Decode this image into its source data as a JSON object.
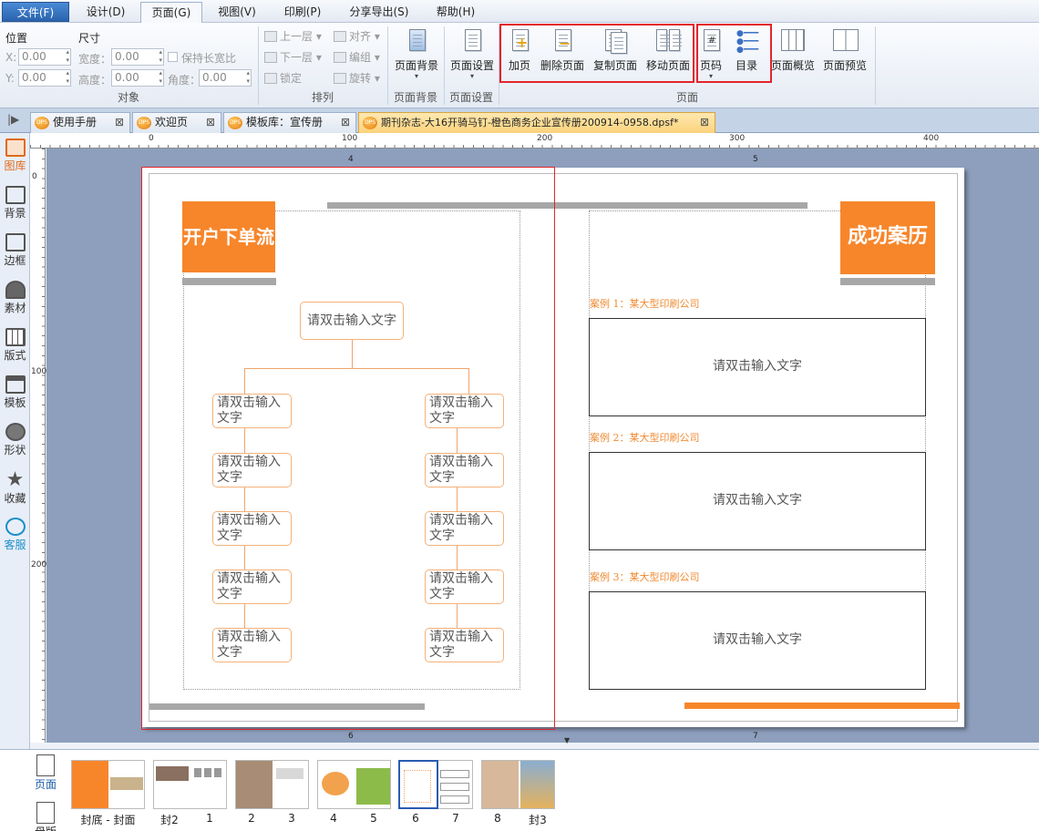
{
  "menu": {
    "file": "文件(F)",
    "items": [
      "设计(D)",
      "页面(G)",
      "视图(V)",
      "印刷(P)",
      "分享导出(S)",
      "帮助(H)"
    ]
  },
  "ribbon": {
    "object": {
      "position": "位置",
      "size": "尺寸",
      "x": "X:",
      "y": "Y:",
      "x_val": "0.00",
      "y_val": "0.00",
      "width": "宽度：",
      "height": "高度：",
      "angle": "角度：",
      "w_val": "0.00",
      "h_val": "0.00",
      "a_val": "0.00",
      "keep_ratio": "保持长宽比",
      "group": "对象"
    },
    "arrange": {
      "up": "上一层",
      "down": "下一层",
      "lock": "锁定",
      "align": "对齐",
      "group_cmd": "编组",
      "rotate": "旋转",
      "group": "排列"
    },
    "bg": {
      "label": "页面背景",
      "group": "页面背景"
    },
    "setup": {
      "label": "页面设置",
      "group": "页面设置"
    },
    "page": {
      "add": "加页",
      "delete": "删除页面",
      "copy": "复制页面",
      "move": "移动页面",
      "pagenum": "页码",
      "toc": "目录",
      "overview": "页面概览",
      "preview": "页面预览",
      "group": "页面"
    }
  },
  "tabs": [
    "使用手册",
    "欢迎页",
    "模板库：宣传册",
    "期刊杂志-大16开骑马钉-橙色商务企业宣传册200914-0958.dpsf*"
  ],
  "left_tools": [
    "图库",
    "背景",
    "边框",
    "素材",
    "版式",
    "模板",
    "形状",
    "收藏",
    "客服"
  ],
  "ruler": {
    "top": [
      "0",
      "100",
      "200",
      "300",
      "400"
    ],
    "left": [
      "0",
      "100",
      "200"
    ],
    "page_top": [
      "4",
      "5"
    ],
    "page_bottom": [
      "6",
      "7"
    ]
  },
  "page_left": {
    "title": "开户下单流程",
    "top_box": "请双击输入文字",
    "box_text": "请双击输入文字"
  },
  "page_right": {
    "title": "成功案历",
    "cases": [
      {
        "label": "案例 1：某大型印刷公司",
        "text": "请双击输入文字"
      },
      {
        "label": "案例 2：某大型印刷公司",
        "text": "请双击输入文字"
      },
      {
        "label": "案例 3：某大型印刷公司",
        "text": "请双击输入文字"
      }
    ]
  },
  "bottom": {
    "tab_page": "页面",
    "tab_second": "母版",
    "thumb_labels": [
      "封底 - 封面",
      "封2",
      "1",
      "2",
      "3",
      "4",
      "5",
      "6",
      "7",
      "8",
      "封3"
    ]
  },
  "colors": {
    "accent": "#f7862b",
    "selection": "#e2252c"
  }
}
